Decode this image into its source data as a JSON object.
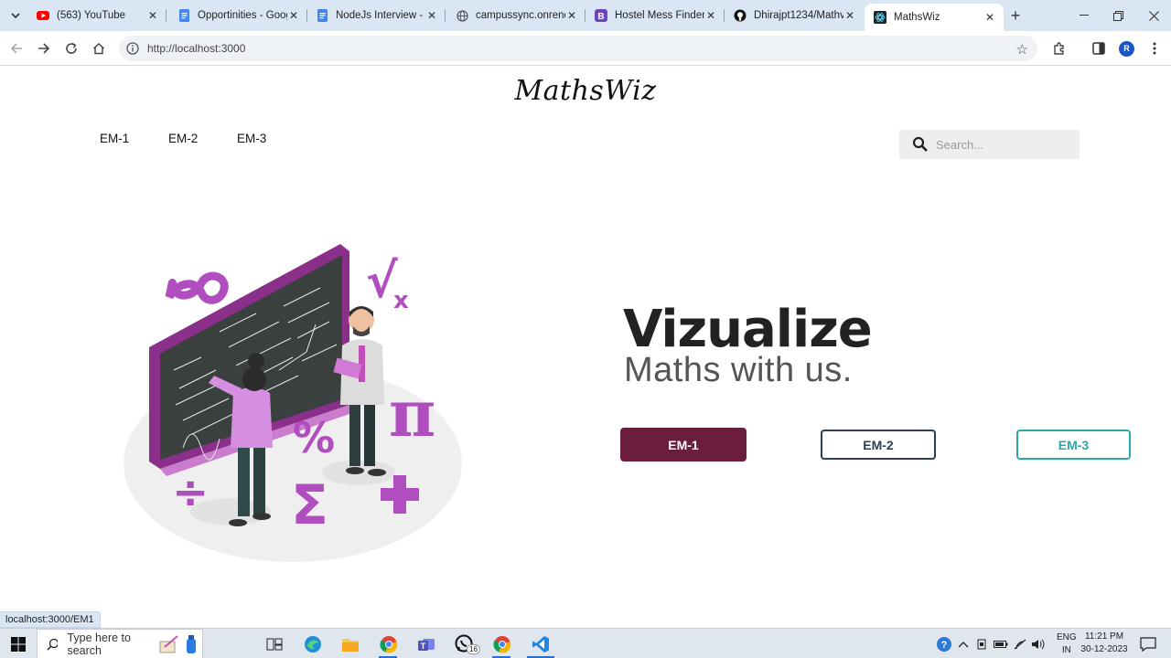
{
  "browser": {
    "tabs": [
      {
        "title": "(563) YouTube",
        "icon": "youtube-icon"
      },
      {
        "title": "Opportinities - Googl",
        "icon": "google-docs-icon"
      },
      {
        "title": "NodeJs Interview - G",
        "icon": "google-docs-icon"
      },
      {
        "title": "campussync.onrende",
        "icon": "globe-icon"
      },
      {
        "title": "Hostel Mess Finder",
        "icon": "bootstrap-icon"
      },
      {
        "title": "Dhirajpt1234/Mathv",
        "icon": "github-icon"
      },
      {
        "title": "MathsWiz",
        "icon": "react-icon",
        "active": true
      }
    ],
    "url": "http://localhost:3000",
    "profile_initial": "R",
    "status_url": "localhost:3000/EM1"
  },
  "page": {
    "logo": "MathsWiz",
    "nav": [
      "EM-1",
      "EM-2",
      "EM-3"
    ],
    "search_placeholder": "Search...",
    "hero_title": "Vizualize",
    "hero_subtitle": "Maths with us.",
    "buttons": [
      "EM-1",
      "EM-2",
      "EM-3"
    ],
    "colors": {
      "primary": "#6b1d3d",
      "secondary": "#2b4054",
      "accent": "#2aa8a8",
      "illustration": "#b04ec0"
    }
  },
  "taskbar": {
    "search_placeholder": "Type here to search",
    "whatsapp_badge": "16",
    "lang": "ENG",
    "region": "IN",
    "time": "11:21 PM",
    "date": "30-12-2023"
  }
}
